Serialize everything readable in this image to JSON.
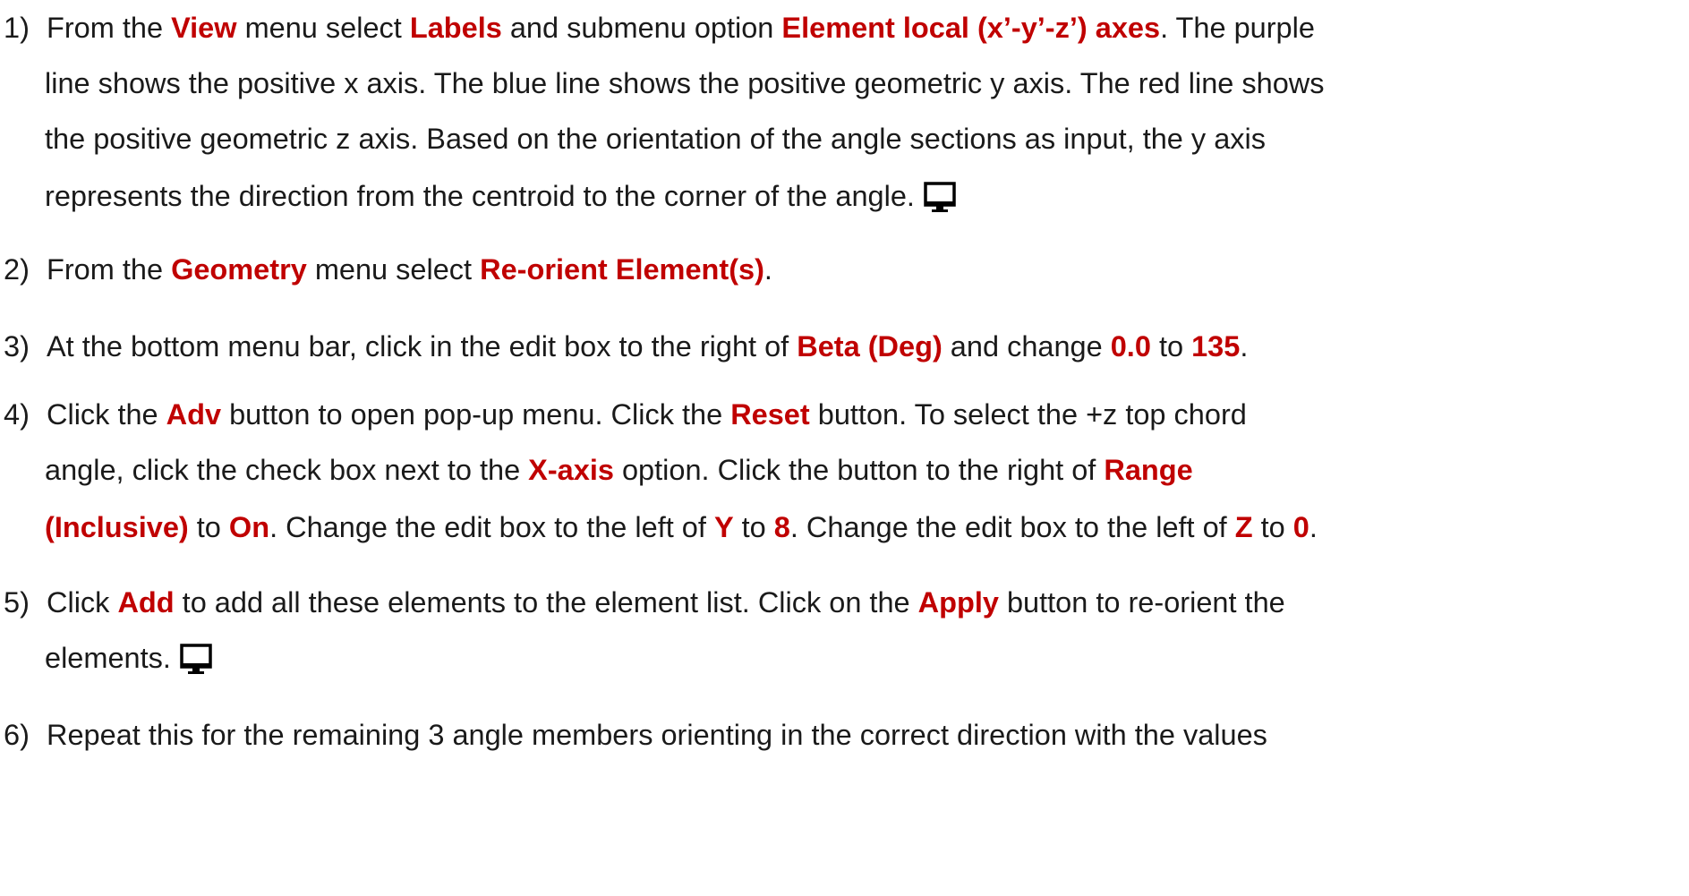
{
  "step1": {
    "num": "1)",
    "line1": [
      {
        "t": "From the ",
        "h": false
      },
      {
        "t": "View",
        "h": true
      },
      {
        "t": " menu select ",
        "h": false
      },
      {
        "t": "Labels",
        "h": true
      },
      {
        "t": " and submenu option ",
        "h": false
      },
      {
        "t": "Element local (x’-y’-z’) axes",
        "h": true
      },
      {
        "t": ". The purple",
        "h": false
      }
    ],
    "line2": "line shows the positive x axis. The blue line shows the positive geometric y axis. The red line shows",
    "line3": "the positive geometric z axis. Based on the orientation of the angle sections as input, the y axis",
    "line4": "represents the direction from the centroid to the corner of the angle.",
    "icon": "monitor-icon"
  },
  "step2": {
    "num": "2)",
    "line1": [
      {
        "t": "From the ",
        "h": false
      },
      {
        "t": "Geometry",
        "h": true
      },
      {
        "t": " menu select ",
        "h": false
      },
      {
        "t": "Re-orient Element(s)",
        "h": true
      },
      {
        "t": ".",
        "h": false
      }
    ]
  },
  "step3": {
    "num": "3)",
    "line1": [
      {
        "t": "At the bottom menu bar, click in the edit box to the right of ",
        "h": false
      },
      {
        "t": "Beta (Deg)",
        "h": true
      },
      {
        "t": " and change ",
        "h": false
      },
      {
        "t": "0.0",
        "h": true
      },
      {
        "t": " to ",
        "h": false
      },
      {
        "t": "135",
        "h": true
      },
      {
        "t": ".",
        "h": false
      }
    ]
  },
  "step4": {
    "num": "4)",
    "line1": [
      {
        "t": "Click the ",
        "h": false
      },
      {
        "t": "Adv",
        "h": true
      },
      {
        "t": " button to open pop-up menu. Click the ",
        "h": false
      },
      {
        "t": "Reset",
        "h": true
      },
      {
        "t": " button. To select the +z top chord",
        "h": false
      }
    ],
    "line2": [
      {
        "t": "angle, click the check box next to the ",
        "h": false
      },
      {
        "t": "X-axis",
        "h": true
      },
      {
        "t": " option. Click the button to the right of ",
        "h": false
      },
      {
        "t": "Range",
        "h": true
      }
    ],
    "line3": [
      {
        "t": "(Inclusive)",
        "h": true
      },
      {
        "t": " to ",
        "h": false
      },
      {
        "t": "On",
        "h": true
      },
      {
        "t": ". Change the edit box to the left of ",
        "h": false
      },
      {
        "t": "Y",
        "h": true
      },
      {
        "t": " to ",
        "h": false
      },
      {
        "t": "8",
        "h": true
      },
      {
        "t": ". Change the edit box to the left of ",
        "h": false
      },
      {
        "t": "Z",
        "h": true
      },
      {
        "t": " to ",
        "h": false
      },
      {
        "t": "0",
        "h": true
      },
      {
        "t": ".",
        "h": false
      }
    ]
  },
  "step5": {
    "num": "5)",
    "line1": [
      {
        "t": "Click ",
        "h": false
      },
      {
        "t": "Add",
        "h": true
      },
      {
        "t": " to add all these elements to the element list. Click on the ",
        "h": false
      },
      {
        "t": "Apply",
        "h": true
      },
      {
        "t": " button to re-orient the",
        "h": false
      }
    ],
    "line2": "elements.",
    "icon": "monitor-icon"
  },
  "step6": {
    "num": "6)",
    "line1": "Repeat this for the remaining 3 angle members orienting in the correct direction with the values"
  },
  "colors": {
    "highlight": "#c00000",
    "text": "#1a1a1a",
    "background": "#ffffff"
  }
}
